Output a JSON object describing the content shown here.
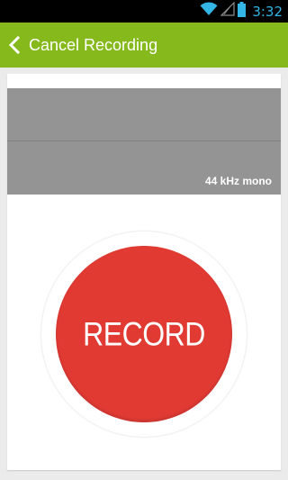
{
  "status_bar": {
    "time": "3:32",
    "icons": [
      "wifi-icon",
      "cell-signal-icon",
      "battery-icon"
    ],
    "time_color": "#33b5e5"
  },
  "action_bar": {
    "title": "Cancel Recording",
    "back_icon": "chevron-left-icon",
    "color": "#86b91b"
  },
  "waveform": {
    "format_label": "44 kHz mono"
  },
  "record": {
    "label": "RECORD",
    "color": "#e03a33"
  }
}
